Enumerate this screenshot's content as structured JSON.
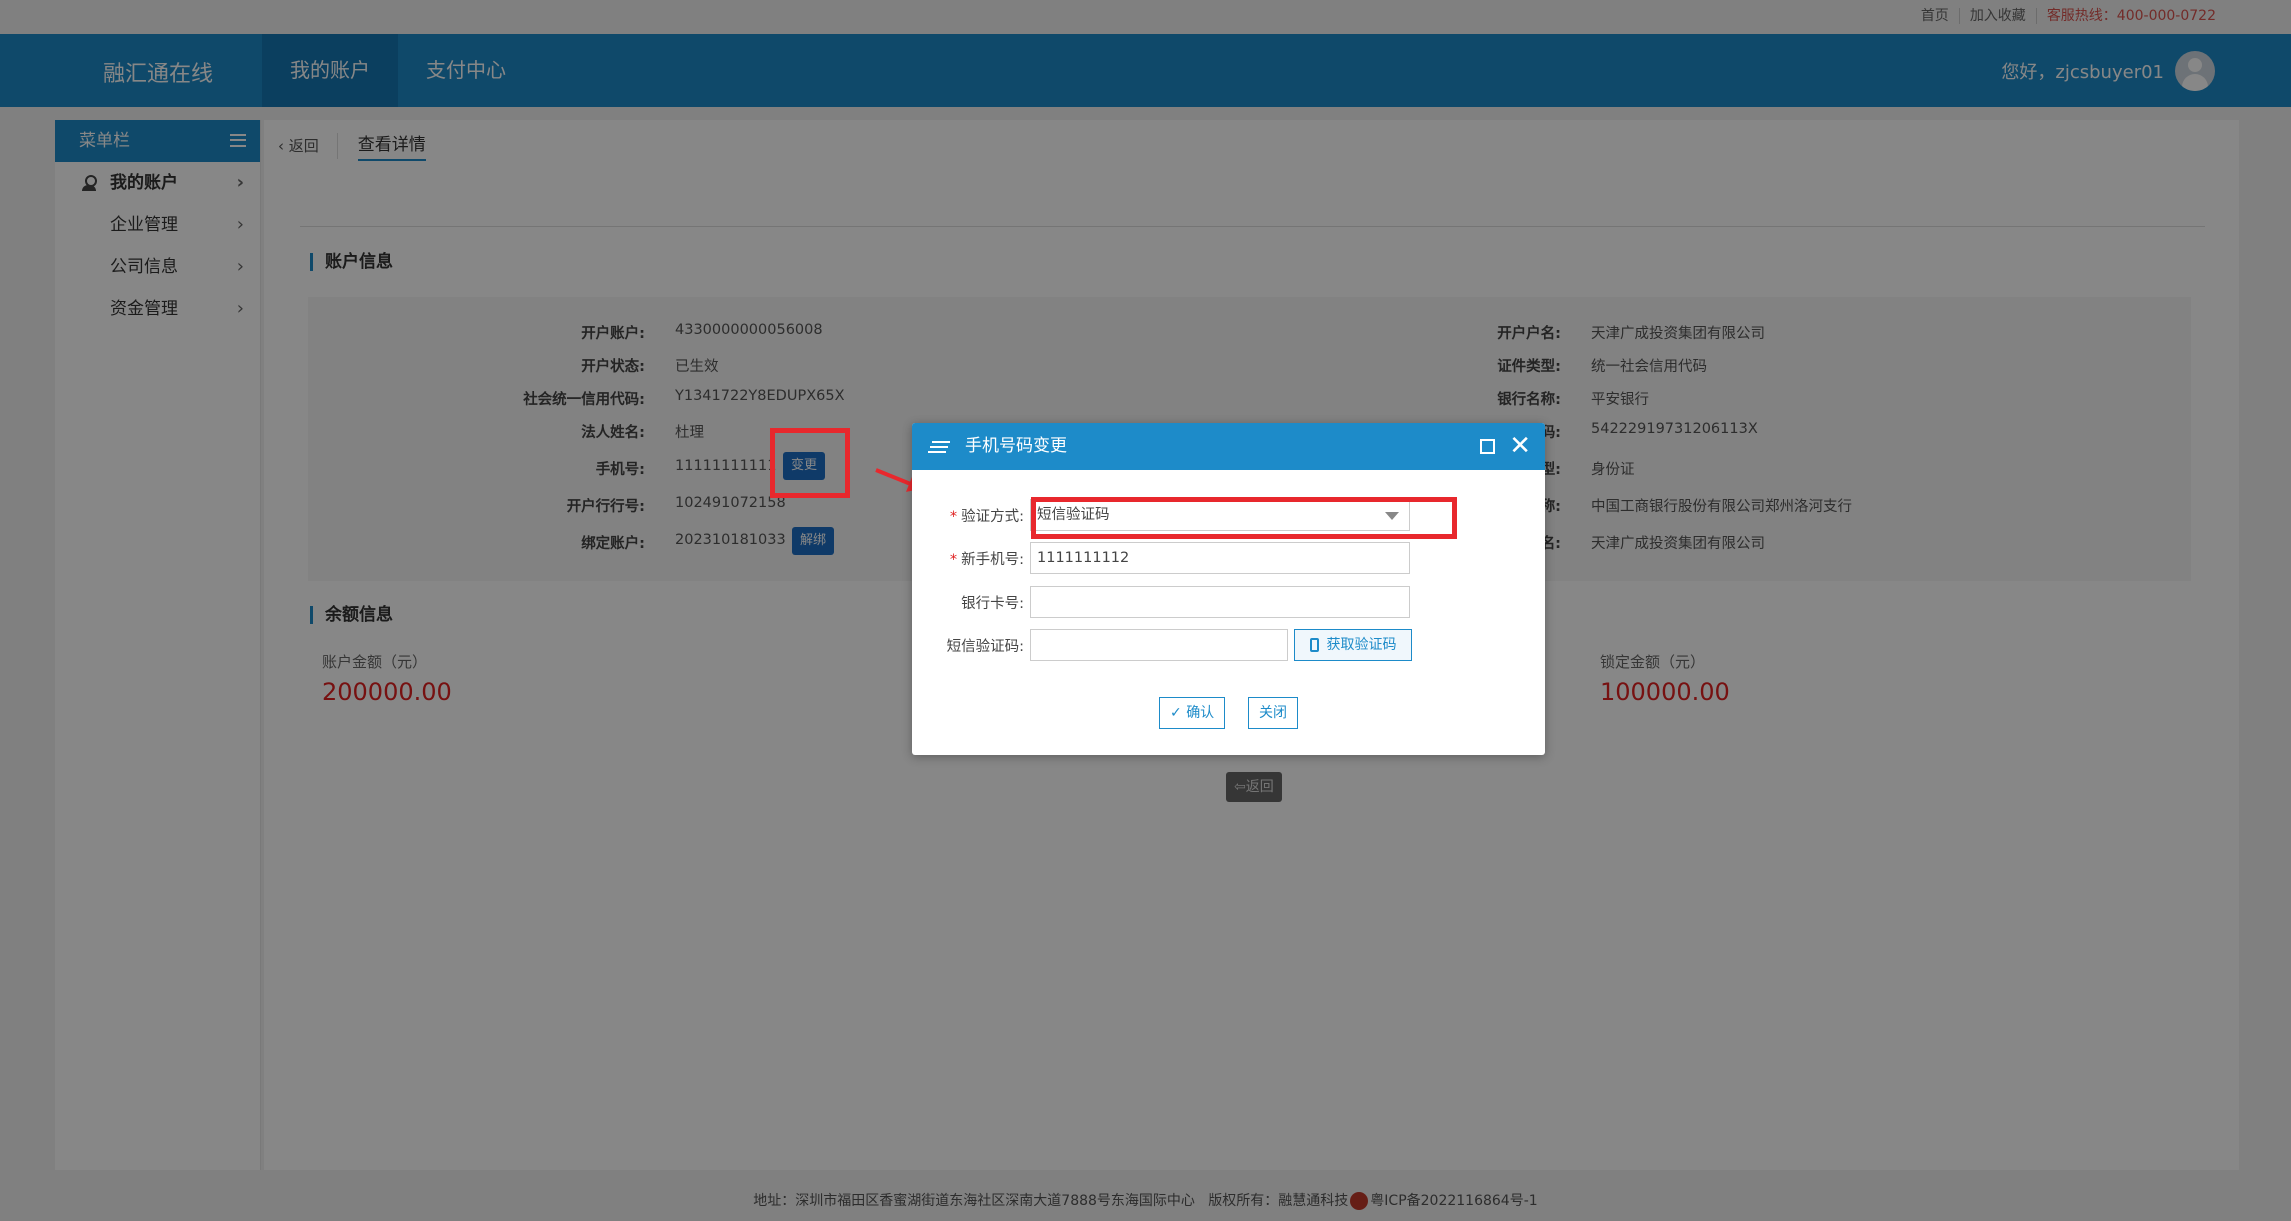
{
  "toplinks": [
    "首页",
    "加入收藏",
    "客服热线：400-000-0722"
  ],
  "header": {
    "logo": "融汇通在线",
    "nav": [
      "我的账户",
      "支付中心"
    ],
    "greeting": "您好，zjcsbuyer01"
  },
  "sidebar": {
    "title": "菜单栏",
    "items": [
      {
        "label": "我的账户",
        "chevron": "›"
      },
      {
        "label": "企业管理",
        "chevron": "›"
      },
      {
        "label": "公司信息",
        "chevron": "›"
      },
      {
        "label": "资金管理",
        "chevron": "›"
      }
    ]
  },
  "tabs": {
    "back": "返回",
    "detail": "查看详情"
  },
  "account_info": {
    "title": "账户信息",
    "left": [
      {
        "label": "开户账户:",
        "value": "4330000000056008"
      },
      {
        "label": "开户状态:",
        "value": "已生效"
      },
      {
        "label": "社会统一信用代码:",
        "value": "Y1341722Y8EDUPX65X"
      },
      {
        "label": "法人姓名:",
        "value": "杜理"
      },
      {
        "label": "手机号:",
        "value": "11111111111"
      },
      {
        "label": "开户行行号:",
        "value": "102491072158"
      },
      {
        "label": "绑定账户:",
        "value": "202310181033"
      }
    ],
    "right": [
      {
        "label": "开户户名:",
        "value": "天津广成投资集团有限公司"
      },
      {
        "label": "证件类型:",
        "value": "统一社会信用代码"
      },
      {
        "label": "银行名称:",
        "value": "平安银行"
      },
      {
        "label": "码:",
        "value": "54222919731206113X"
      },
      {
        "label": "型:",
        "value": "身份证"
      },
      {
        "label": "称:",
        "value": "中国工商银行股份有限公司郑州洛河支行"
      },
      {
        "label": "名:",
        "value": "天津广成投资集团有限公司"
      }
    ],
    "change_btn": "变更",
    "unbind_btn": "解绑"
  },
  "balance": {
    "title": "余额信息",
    "account_label": "账户金额（元）",
    "account_value": "200000.00",
    "frozen_label": "锁定金额（元）",
    "frozen_value": "100000.00"
  },
  "back_button": "返回",
  "footer": {
    "address": "地址：深圳市福田区香蜜湖街道东海社区深南大道7888号东海国际中心",
    "copyright": "版权所有：融慧通科技",
    "icp": "粤ICP备2022116864号-1"
  },
  "dialog": {
    "title": "手机号码变更",
    "fields": {
      "verify_label": "验证方式:",
      "verify_value": "短信验证码",
      "new_phone_label": "新手机号:",
      "new_phone_value": "1111111112",
      "bank_card_label": "银行卡号:",
      "bank_card_value": "",
      "sms_label": "短信验证码:",
      "sms_value": ""
    },
    "get_code": "获取验证码",
    "confirm": "确认",
    "close": "关闭",
    "required_mark": "*",
    "close_glyph": "✕"
  }
}
